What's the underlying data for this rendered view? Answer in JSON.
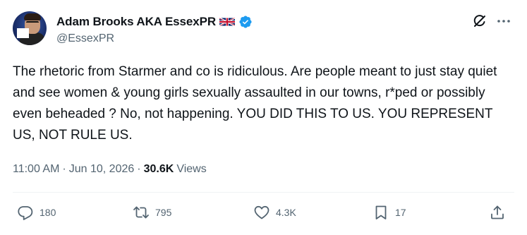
{
  "author": {
    "display_name": "Adam Brooks AKA EssexPR",
    "handle": "@EssexPR",
    "flag": "uk-flag",
    "verified": true,
    "avatar": "profile-photo"
  },
  "tweet": {
    "text": "The rhetoric from Starmer and co is ridiculous. Are people meant to just stay quiet and see women & young girls sexually assaulted in our towns, r*ped or possibly even beheaded ? No, not happening. YOU DID THIS TO US. YOU REPRESENT US, NOT RULE US."
  },
  "meta": {
    "time": "11:00 AM",
    "date": "Jun 10, 2026",
    "views_count": "30.6K",
    "views_label": "Views"
  },
  "actions": {
    "replies": "180",
    "reposts": "795",
    "likes": "4.3K",
    "bookmarks": "17"
  },
  "icons": [
    "grok-icon",
    "more-icon",
    "reply-icon",
    "repost-icon",
    "like-icon",
    "bookmark-icon",
    "share-icon",
    "verified-badge-icon"
  ],
  "colors": {
    "text_primary": "#0f1419",
    "text_secondary": "#536471",
    "verified_blue": "#1d9bf0"
  }
}
